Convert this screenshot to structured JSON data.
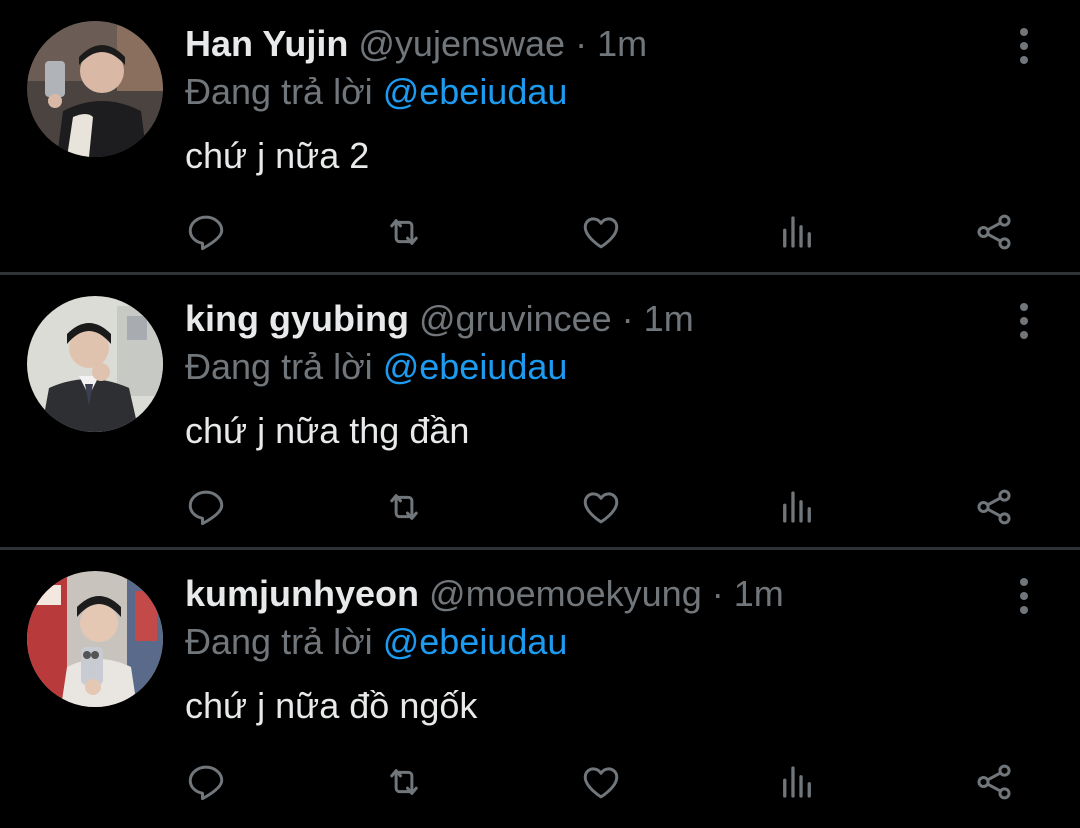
{
  "tweets": [
    {
      "display_name": "Han Yujin",
      "handle": "@yujenswae",
      "separator": "·",
      "time": "1m",
      "reply_prefix": "Đang trả lời",
      "reply_to": "@ebeiudau",
      "text": "chứ j nữa 2"
    },
    {
      "display_name": "king gyubing",
      "handle": "@gruvincee",
      "separator": "·",
      "time": "1m",
      "reply_prefix": "Đang trả lời",
      "reply_to": "@ebeiudau",
      "text": "chứ j nữa thg đần"
    },
    {
      "display_name": "kumjunhyeon",
      "handle": "@moemoekyung",
      "separator": "·",
      "time": "1m",
      "reply_prefix": "Đang trả lời",
      "reply_to": "@ebeiudau",
      "text": "chứ j nữa đồ ngốk"
    }
  ],
  "icons": {
    "more": "more-vertical-icon",
    "reply": "reply-bubble-icon",
    "retweet": "retweet-icon",
    "like": "heart-icon",
    "views": "views-bar-chart-icon",
    "share": "share-icon"
  },
  "colors": {
    "background": "#000000",
    "text": "#e7e9ea",
    "muted": "#71767b",
    "mention": "#1d9bf0",
    "divider": "#2f3336"
  }
}
